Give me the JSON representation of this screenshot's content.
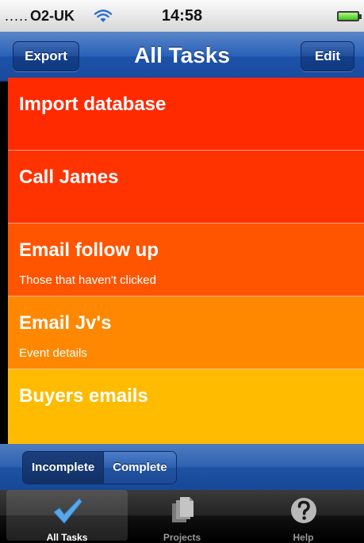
{
  "status_bar": {
    "carrier_dots": ".....",
    "carrier": "O2-UK",
    "time": "14:58"
  },
  "nav_bar": {
    "title": "All Tasks",
    "left_button": "Export",
    "right_button": "Edit"
  },
  "tasks": [
    {
      "title": "Import database",
      "subtitle": "",
      "color": "#ff2a00"
    },
    {
      "title": "Call James",
      "subtitle": "",
      "color": "#ff3300"
    },
    {
      "title": "Email follow up",
      "subtitle": "Those that haven't clicked",
      "color": "#ff5500"
    },
    {
      "title": "Email Jv's",
      "subtitle": "Event details",
      "color": "#ff8800"
    },
    {
      "title": "Buyers emails",
      "subtitle": "",
      "color": "#ffbb00"
    }
  ],
  "filter": {
    "options": [
      "Incomplete",
      "Complete"
    ],
    "selected": "Incomplete"
  },
  "tab_bar": {
    "items": [
      {
        "label": "All Tasks",
        "icon": "checkmark-icon",
        "active": true
      },
      {
        "label": "Projects",
        "icon": "documents-icon",
        "active": false
      },
      {
        "label": "Help",
        "icon": "question-icon",
        "active": false
      }
    ]
  },
  "colors": {
    "nav_blue": "#2860b8",
    "accent_check": "#5aa8e8"
  }
}
